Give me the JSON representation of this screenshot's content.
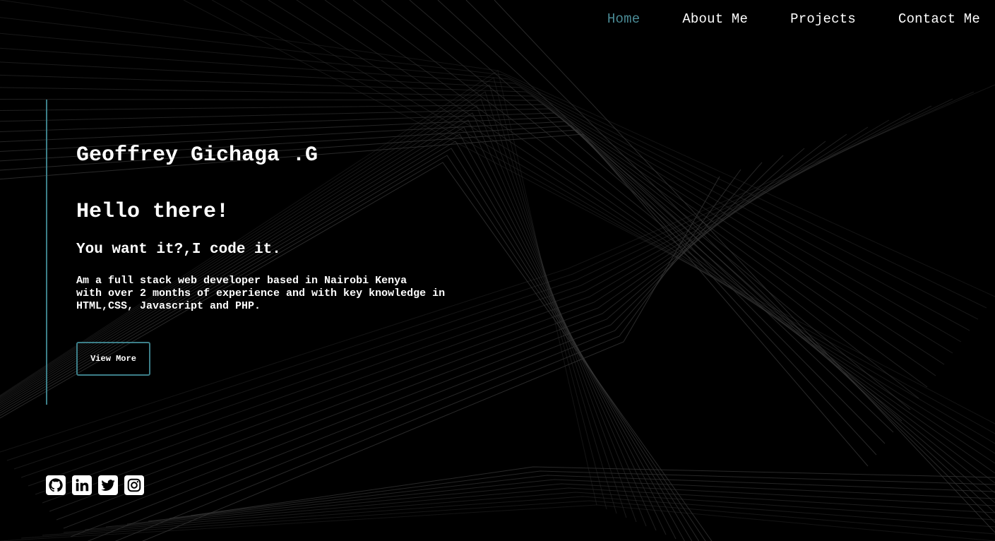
{
  "nav": {
    "items": [
      {
        "label": "Home",
        "active": true
      },
      {
        "label": "About Me",
        "active": false
      },
      {
        "label": "Projects",
        "active": false
      },
      {
        "label": "Contact Me",
        "active": false
      }
    ]
  },
  "hero": {
    "name": "Geoffrey Gichaga .G",
    "greeting": "Hello there!",
    "tagline": "You want it?,I code it.",
    "bio_lines": [
      "Am a full stack web developer based in Nairobi Kenya",
      "with over 2 months of experience and with key knowledge in",
      "HTML,CSS, Javascript and PHP."
    ],
    "button_label": "View More"
  },
  "socials": [
    {
      "name": "github-icon"
    },
    {
      "name": "linkedin-icon"
    },
    {
      "name": "twitter-icon"
    },
    {
      "name": "instagram-icon"
    }
  ],
  "colors": {
    "background": "#000000",
    "accent": "#3c7f89",
    "active_nav": "#4a8a95",
    "text": "#ffffff",
    "lines": "#3a3a3a"
  }
}
